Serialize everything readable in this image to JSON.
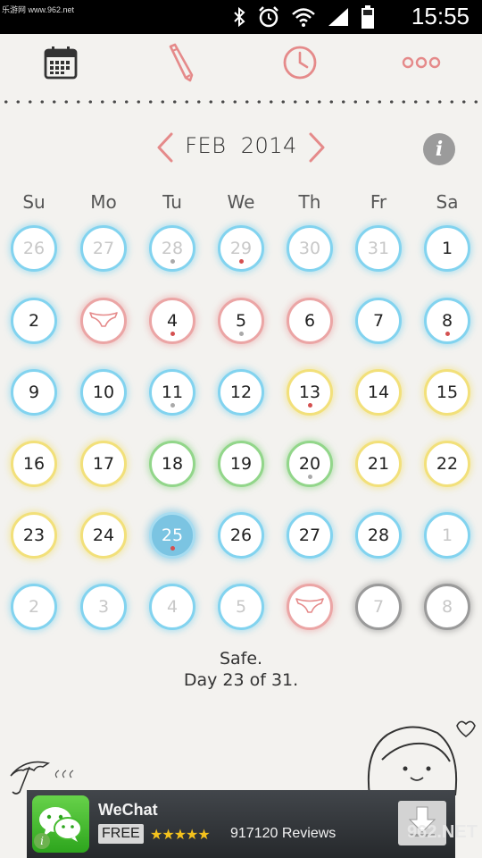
{
  "status_bar": {
    "site": "乐游网 www.962.net",
    "time": "15:55",
    "icons": [
      "bluetooth-icon",
      "alarm-icon",
      "wifi-icon",
      "signal-icon",
      "battery-icon"
    ]
  },
  "toolbar": {
    "items": [
      "calendar-icon",
      "pencil-icon",
      "clock-icon",
      "more-icon"
    ],
    "accent_color": "#e58a8a"
  },
  "header": {
    "month": "FEB",
    "year": "2014",
    "info_label": "i"
  },
  "weekdays": [
    "Su",
    "Mo",
    "Tu",
    "We",
    "Th",
    "Fr",
    "Sa"
  ],
  "days": [
    {
      "label": "26",
      "other": true,
      "ring": "blue"
    },
    {
      "label": "27",
      "other": true,
      "ring": "blue"
    },
    {
      "label": "28",
      "other": true,
      "ring": "blue",
      "dot": "gray"
    },
    {
      "label": "29",
      "other": true,
      "ring": "blue",
      "dot": "red"
    },
    {
      "label": "30",
      "other": true,
      "ring": "blue"
    },
    {
      "label": "31",
      "other": true,
      "ring": "blue"
    },
    {
      "label": "1",
      "ring": "blue"
    },
    {
      "label": "2",
      "ring": "blue"
    },
    {
      "label": "",
      "ring": "pink",
      "icon": "underwear-icon"
    },
    {
      "label": "4",
      "ring": "pink",
      "dot": "red"
    },
    {
      "label": "5",
      "ring": "pink",
      "dot": "gray"
    },
    {
      "label": "6",
      "ring": "pink"
    },
    {
      "label": "7",
      "ring": "blue"
    },
    {
      "label": "8",
      "ring": "blue",
      "dot": "red"
    },
    {
      "label": "9",
      "ring": "blue"
    },
    {
      "label": "10",
      "ring": "blue"
    },
    {
      "label": "11",
      "ring": "blue",
      "dot": "gray"
    },
    {
      "label": "12",
      "ring": "blue"
    },
    {
      "label": "13",
      "ring": "yellow",
      "dot": "red"
    },
    {
      "label": "14",
      "ring": "yellow"
    },
    {
      "label": "15",
      "ring": "yellow"
    },
    {
      "label": "16",
      "ring": "yellow"
    },
    {
      "label": "17",
      "ring": "yellow"
    },
    {
      "label": "18",
      "ring": "green"
    },
    {
      "label": "19",
      "ring": "green"
    },
    {
      "label": "20",
      "ring": "green",
      "dot": "gray"
    },
    {
      "label": "21",
      "ring": "yellow"
    },
    {
      "label": "22",
      "ring": "yellow"
    },
    {
      "label": "23",
      "ring": "yellow"
    },
    {
      "label": "24",
      "ring": "yellow"
    },
    {
      "label": "25",
      "ring": "blue",
      "today": true,
      "dot": "red"
    },
    {
      "label": "26",
      "ring": "blue"
    },
    {
      "label": "27",
      "ring": "blue"
    },
    {
      "label": "28",
      "ring": "blue"
    },
    {
      "label": "1",
      "other": true,
      "ring": "blue"
    },
    {
      "label": "2",
      "other": true,
      "ring": "blue"
    },
    {
      "label": "3",
      "other": true,
      "ring": "blue"
    },
    {
      "label": "4",
      "other": true,
      "ring": "blue"
    },
    {
      "label": "5",
      "other": true,
      "ring": "blue"
    },
    {
      "label": "",
      "other": true,
      "ring": "pink",
      "icon": "underwear-icon"
    },
    {
      "label": "7",
      "other": true,
      "ring": "gray"
    },
    {
      "label": "8",
      "other": true,
      "ring": "gray"
    }
  ],
  "status": {
    "line1": "Safe.",
    "line2": "Day 23 of 31."
  },
  "ad": {
    "app_name": "WeChat",
    "price": "FREE",
    "stars": "★★★★★",
    "reviews": "917120 Reviews",
    "watermark": "962.NET"
  }
}
